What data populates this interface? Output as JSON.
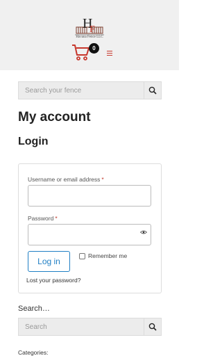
{
  "header": {
    "logo_text": "Havana Fence LLC",
    "cart_count": "0",
    "accent_color": "#c7362b"
  },
  "top_search": {
    "placeholder": "Search your fence",
    "icon": "search-icon"
  },
  "main": {
    "page_title": "My account",
    "login_title": "Login"
  },
  "login_form": {
    "username_label": "Username or email address",
    "password_label": "Password",
    "required_mark": "*",
    "login_button": "Log in",
    "remember_label": "Remember me",
    "lost_password": "Lost your password?"
  },
  "sidebar": {
    "search_heading": "Search…",
    "search_placeholder": "Search",
    "categories_label": "Categories:"
  }
}
